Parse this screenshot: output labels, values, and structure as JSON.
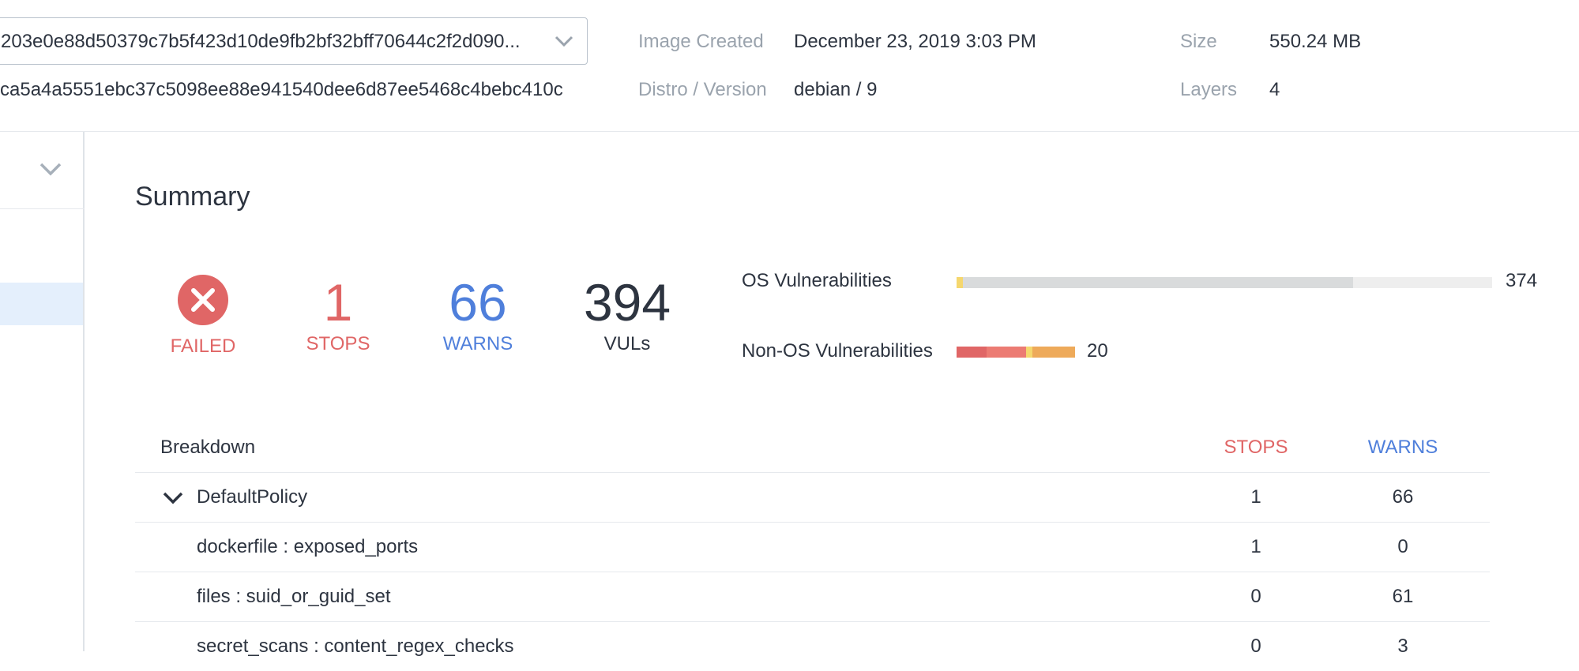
{
  "header": {
    "image_digest": "203e0e88d50379c7b5f423d10de9fb2bf32bff70644c2f2d090...",
    "image_id": "ca5a4a5551ebc37c5098ee88e941540dee6d87ee5468c4bebc410c",
    "image_created_label": "Image Created",
    "image_created_value": "December 23, 2019 3:03 PM",
    "distro_label": "Distro / Version",
    "distro_value": "debian / 9",
    "size_label": "Size",
    "size_value": "550.24 MB",
    "layers_label": "Layers",
    "layers_value": "4"
  },
  "summary": {
    "title": "Summary",
    "status": "FAILED",
    "stops_value": "1",
    "stops_label": "STOPS",
    "warns_value": "66",
    "warns_label": "WARNS",
    "vuls_value": "394",
    "vuls_label": "VULs"
  },
  "vulnerabilities": {
    "os_label": "OS Vulnerabilities",
    "os_count": "374",
    "nonos_label": "Non-OS Vulnerabilities",
    "nonos_count": "20"
  },
  "breakdown": {
    "title": "Breakdown",
    "stops_header": "STOPS",
    "warns_header": "WARNS",
    "policy": {
      "name": "DefaultPolicy",
      "stops": "1",
      "warns": "66"
    },
    "rows": [
      {
        "name": "dockerfile : exposed_ports",
        "stops": "1",
        "warns": "0"
      },
      {
        "name": "files : suid_or_guid_set",
        "stops": "0",
        "warns": "61"
      },
      {
        "name": "secret_scans : content_regex_checks",
        "stops": "0",
        "warns": "3"
      }
    ]
  },
  "colors": {
    "failed_red": "#e06666",
    "warn_blue": "#4f7fdb",
    "bar_yellow": "#f5d76e",
    "bar_orange": "#eeaa5a",
    "bar_salmon": "#ec7b73",
    "bar_grey": "#d9dbdc"
  },
  "icons": {
    "failed": "x-circle-icon",
    "dropdown": "chevron-down-icon",
    "expand": "chevron-down-icon"
  }
}
